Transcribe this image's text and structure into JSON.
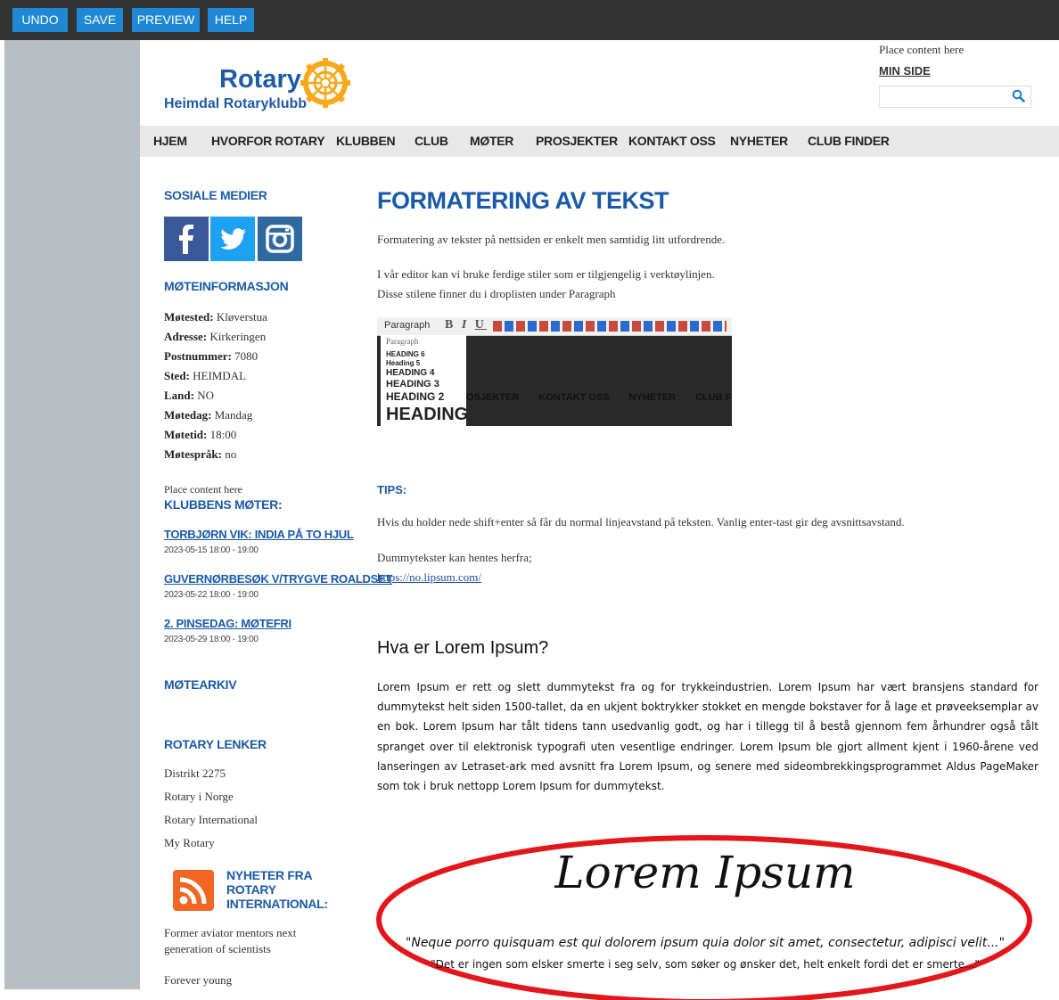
{
  "toolbar": {
    "undo": "UNDO",
    "save": "SAVE",
    "preview": "PREVIEW",
    "help": "HELP"
  },
  "header": {
    "logo_word": "Rotary",
    "club_name": "Heimdal Rotaryklubb",
    "place_content": "Place content here",
    "min_side": "MIN SIDE",
    "search_placeholder": ""
  },
  "nav": [
    "HJEM",
    "HVORFOR ROTARY",
    "KLUBBEN",
    "CLUB",
    "MØTER",
    "PROSJEKTER",
    "KONTAKT OSS",
    "NYHETER",
    "CLUB FINDER"
  ],
  "sidebar": {
    "social_heading": "SOSIALE MEDIER",
    "meeting_heading": "MØTEINFORMASJON",
    "meeting_info": [
      {
        "label": "Møtested:",
        "value": " Kløverstua"
      },
      {
        "label": "Adresse:",
        "value": " Kirkeringen"
      },
      {
        "label": "Postnummer:",
        "value": " 7080"
      },
      {
        "label": "Sted:",
        "value": " HEIMDAL"
      },
      {
        "label": "Land:",
        "value": " NO"
      },
      {
        "label": "Møtedag:",
        "value": " Mandag"
      },
      {
        "label": "Møtetid:",
        "value": " 18:00"
      },
      {
        "label": "Møtespråk:",
        "value": " no"
      }
    ],
    "place_content": "Place content here",
    "club_meetings_heading": "KLUBBENS MØTER:",
    "events": [
      {
        "title": "TORBJØRN VIK: INDIA PÅ TO HJUL",
        "date": "2023-05-15 18:00 - 19:00"
      },
      {
        "title": "GUVERNØRBESØK V/TRYGVE ROALDSET",
        "date": "2023-05-22 18:00 - 19:00"
      },
      {
        "title": "2. PINSEDAG: MØTEFRI",
        "date": "2023-05-29 18:00 - 19:00"
      }
    ],
    "archive_heading": "MØTEARKIV",
    "links_heading": "ROTARY LENKER",
    "links": [
      "Distrikt 2275",
      "Rotary i Norge",
      "Rotary International",
      "My Rotary"
    ],
    "news_heading_1": "NYHETER FRA",
    "news_heading_2": "ROTARY",
    "news_heading_3": "INTERNATIONAL:",
    "news_items": [
      "Former aviator mentors next",
      "generation of scientists",
      "Forever young"
    ]
  },
  "main": {
    "title": "FORMATERING AV TEKST",
    "p1": "Formatering av tekster på nettsiden er enkelt men samtidig litt utfordrende.",
    "p2": "I vår editor kan vi bruke ferdige stiler som er tilgjengelig i verktøylinjen.",
    "p3": "Disse stilene finner du i droplisten under Paragraph",
    "editor_image": {
      "paragraph_label": "Paragraph",
      "dropdown": [
        "Paragraph",
        "HEADING 6",
        "Heading 5",
        "HEADING 4",
        "HEADING 3",
        "HEADING 2",
        "HEADING"
      ],
      "menu_bg": [
        "OSJEKTER",
        "KONTAKT OSS",
        "NYHETER",
        "CLUB FINDE"
      ]
    },
    "tips_heading": "TIPS:",
    "tips_text": "Hvis du holder nede shift+enter så får du normal linjeavstand på teksten. Vanlig enter-tast gir deg avsnittsavstand.",
    "dummy_text": "Dummytekster kan hentes herfra;",
    "dummy_link": "https://no.lipsum.com/",
    "lorem_heading": "Hva er Lorem Ipsum?",
    "lorem_paragraph": "Lorem Ipsum er rett og slett dummytekst fra og for trykkeindustrien. Lorem Ipsum har vært bransjens standard for dummytekst helt siden 1500-tallet, da en ukjent boktrykker stokket en mengde bokstaver for å lage et prøveeksemplar av en bok. Lorem Ipsum har tålt tidens tann usedvanlig godt, og har i tillegg til å bestå gjennom fem århundrer også tålt spranget over til elektronisk typografi uten vesentlige endringer. Lorem Ipsum ble gjort allment kjent i 1960-årene ved lanseringen av Letraset-ark med avsnitt fra Lorem Ipsum, og senere med sideombrekkingsprogrammet Aldus PageMaker som tok i bruk nettopp Lorem Ipsum for dummytekst.",
    "lorem_big": "Lorem Ipsum",
    "quote_latin": "\"Neque porro quisquam est qui dolorem ipsum quia dolor sit amet, consectetur, adipisci velit...\"",
    "quote_norwegian": "\"Det er ingen som elsker smerte i seg selv, som søker og ønsker det, helt enkelt fordi det er smerte...\""
  },
  "colors": {
    "accent": "#1a5aa8",
    "toolbar_btn": "#1e88d6",
    "rotary_gold": "#f7a81b",
    "oval": "#e3161b"
  }
}
